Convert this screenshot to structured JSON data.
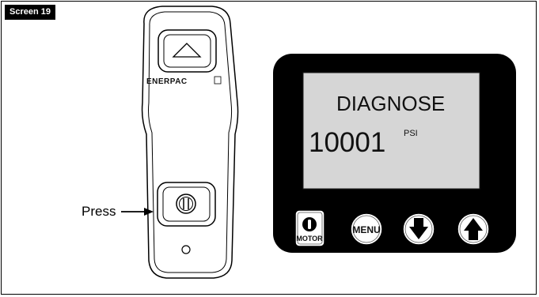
{
  "figure": {
    "tag": "Screen 19",
    "press_label": "Press"
  },
  "pendant": {
    "brand": "ENERPAC",
    "up_icon": "up-triangle-icon",
    "center_button_icon": "rocker-switch-icon",
    "indicator_icon": "led-circle-icon"
  },
  "display": {
    "line1": "DIAGNOSE",
    "value": "10001",
    "unit": "PSI"
  },
  "buttons": {
    "motor_label": "MOTOR",
    "motor_icon": "power-icon",
    "menu_label": "MENU",
    "down_icon": "down-arrow-icon",
    "up_icon": "up-arrow-icon"
  }
}
